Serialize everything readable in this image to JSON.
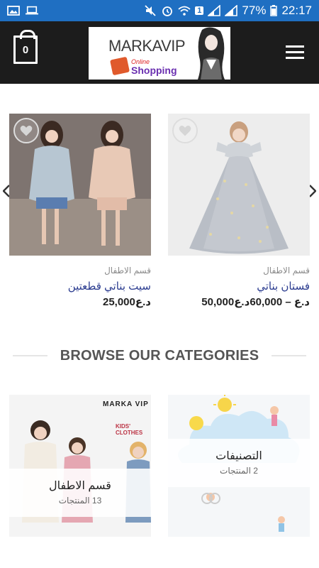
{
  "status_bar": {
    "battery": "77%",
    "time": "22:17",
    "sim_badge": "1"
  },
  "header": {
    "cart_count": "0",
    "logo": {
      "brand": "MARKAVIP",
      "online": "Online",
      "shopping": "Shopping"
    }
  },
  "products": [
    {
      "category": "قسم الاطفال",
      "title": "فستان بناتي",
      "price": "50,000د.ع – 60,000د.ع"
    },
    {
      "category": "قسم الاطفال",
      "title": "سيت بناتي قطعتين",
      "price": "25,000د.ع"
    }
  ],
  "categories_heading": "BROWSE OUR CATEGORIES",
  "categories": [
    {
      "name": "التصنيفات",
      "count": "2 المنتجات"
    },
    {
      "name": "قسم الاطفال",
      "count": "13 المنتجات"
    }
  ],
  "tile_brand": {
    "name": "MARKA VIP",
    "sub": "KIDS' CLOTHES"
  }
}
